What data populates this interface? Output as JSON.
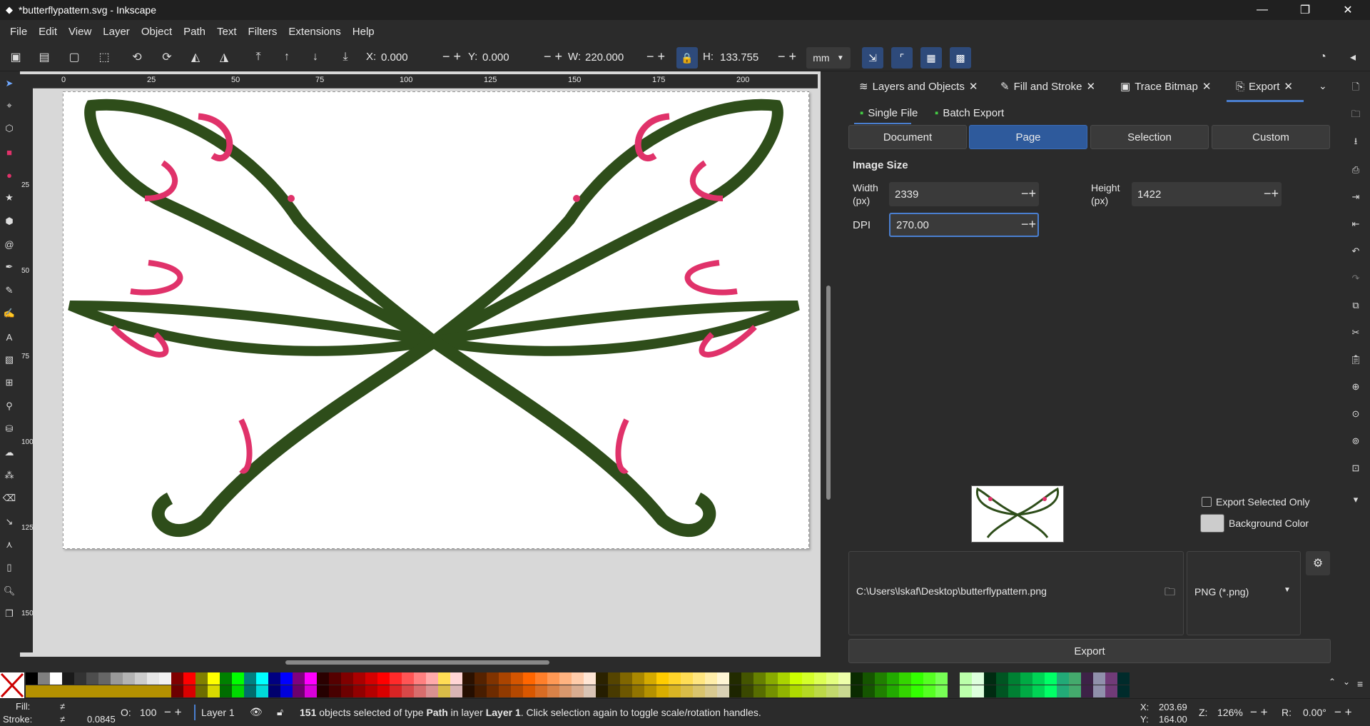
{
  "app": {
    "title": "*butterflypattern.svg - Inkscape"
  },
  "menu": [
    "File",
    "Edit",
    "View",
    "Layer",
    "Object",
    "Path",
    "Text",
    "Filters",
    "Extensions",
    "Help"
  ],
  "toolbar": {
    "x_label": "X:",
    "x_value": "0.000",
    "y_label": "Y:",
    "y_value": "0.000",
    "w_label": "W:",
    "w_value": "220.000",
    "h_label": "H:",
    "h_value": "133.755",
    "unit": "mm"
  },
  "ruler": {
    "h_ticks": [
      "0",
      "25",
      "50",
      "75",
      "100",
      "125",
      "150",
      "175",
      "200"
    ],
    "v_ticks": [
      "25",
      "50",
      "75",
      "100",
      "125",
      "150"
    ]
  },
  "dock": {
    "tabs": [
      "Layers and Objects",
      "Fill and Stroke",
      "Trace Bitmap",
      "Export"
    ],
    "subtabs": [
      "Single File",
      "Batch Export"
    ],
    "area_buttons": [
      "Document",
      "Page",
      "Selection",
      "Custom"
    ],
    "image_size_heading": "Image Size",
    "width_label": "Width\n(px)",
    "width_value": "2339",
    "height_label": "Height\n(px)",
    "height_value": "1422",
    "dpi_label": "DPI",
    "dpi_value": "270.00",
    "export_selected_only": "Export Selected Only",
    "background_color": "Background Color",
    "file_path": "C:\\Users\\lskaf\\Desktop\\butterflypattern.png",
    "file_type": "PNG (*.png)",
    "export_button": "Export"
  },
  "status": {
    "fill_label": "Fill:",
    "fill_value": "≠",
    "stroke_label": "Stroke:",
    "stroke_value": "≠",
    "stroke_width": "0.0845",
    "opacity_label": "O:",
    "opacity_value": "100",
    "layer": "Layer 1",
    "message_count": "151",
    "message_pre": " objects selected of type ",
    "message_type": "Path",
    "message_mid": " in layer ",
    "message_layer": "Layer 1",
    "message_post": ". Click selection again to toggle scale/rotation handles.",
    "cursor_x_label": "X:",
    "cursor_x": "203.69",
    "cursor_y_label": "Y:",
    "cursor_y": "164.00",
    "zoom_label": "Z:",
    "zoom": "126%",
    "rotation_label": "R:",
    "rotation": "0.00°"
  },
  "colors": {
    "accent": "#2e5a9c",
    "wing": "#2e4d1a",
    "spots": "#e0326a"
  }
}
